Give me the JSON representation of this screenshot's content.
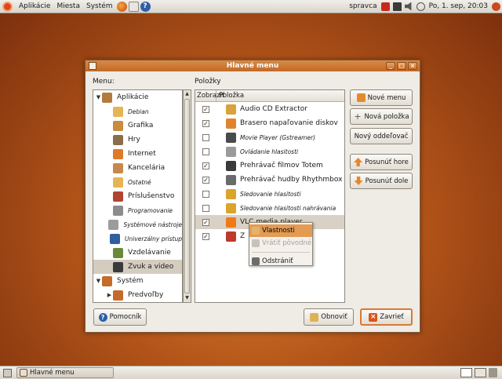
{
  "top_panel": {
    "menus": [
      "Aplikácie",
      "Miesta",
      "Systém"
    ],
    "user": "spravca",
    "clock": "Po, 1. sep, 20:03"
  },
  "window": {
    "title": "Hlavné menu",
    "menus_label": "Menu:",
    "items_label": "Položky",
    "menu_tree": [
      {
        "label": "Aplikácie",
        "expander": "▼",
        "indent": 0,
        "icon_color": "#b37a3e"
      },
      {
        "label": "Debian",
        "indent": 1,
        "italic": true,
        "icon_color": "#e7b455"
      },
      {
        "label": "Grafika",
        "indent": 1,
        "icon_color": "#c98b3d"
      },
      {
        "label": "Hry",
        "indent": 1,
        "icon_color": "#8a6d4a"
      },
      {
        "label": "Internet",
        "indent": 1,
        "icon_color": "#e07a2b"
      },
      {
        "label": "Kancelária",
        "indent": 1,
        "icon_color": "#c7894b"
      },
      {
        "label": "Ostatné",
        "indent": 1,
        "italic": true,
        "icon_color": "#e7b455"
      },
      {
        "label": "Príslušenstvo",
        "indent": 1,
        "icon_color": "#b0442f"
      },
      {
        "label": "Programovanie",
        "indent": 1,
        "italic": true,
        "icon_color": "#8c8c8c"
      },
      {
        "label": "Systémové nástroje",
        "indent": 1,
        "italic": true,
        "icon_color": "#9c9c9c"
      },
      {
        "label": "Univerzálny prístup",
        "indent": 1,
        "italic": true,
        "icon_color": "#2f5f9e"
      },
      {
        "label": "Vzdelávanie",
        "indent": 1,
        "icon_color": "#6a8a3a"
      },
      {
        "label": "Zvuk a video",
        "indent": 1,
        "selected": true,
        "icon_color": "#3a3a3a"
      },
      {
        "label": "Systém",
        "expander": "▼",
        "indent": 0,
        "icon_color": "#c46a2a"
      },
      {
        "label": "Predvoľby",
        "expander": "▶",
        "indent": 1,
        "icon_color": "#c46a2a"
      }
    ],
    "columns": {
      "show": "Zobraziť",
      "item": "Položka"
    },
    "items": [
      {
        "checked": true,
        "label": "Audio CD Extractor",
        "icon_color": "#d8a23c"
      },
      {
        "checked": true,
        "label": "Brasero napaľovanie diskov",
        "icon_color": "#e0842f"
      },
      {
        "checked": false,
        "label": "Movie Player (Gstreamer)",
        "italic": true,
        "icon_color": "#4a4a4a"
      },
      {
        "checked": false,
        "label": "Ovládanie hlasitosti",
        "italic": true,
        "icon_color": "#9a9a9a"
      },
      {
        "checked": true,
        "label": "Prehrávač filmov Totem",
        "icon_color": "#3a3a3a"
      },
      {
        "checked": true,
        "label": "Prehrávač hudby Rhythmbox",
        "icon_color": "#6b6b6b"
      },
      {
        "checked": false,
        "label": "Sledovanie hlasitosti",
        "italic": true,
        "icon_color": "#d9a52a"
      },
      {
        "checked": false,
        "label": "Sledovanie hlasitosti nahrávania",
        "italic": true,
        "icon_color": "#d9a52a"
      },
      {
        "checked": true,
        "label": "VLC media player",
        "selected": true,
        "icon_color": "#f07a16"
      },
      {
        "checked": true,
        "label": "Z",
        "icon_color": "#c0392b"
      }
    ],
    "context_menu": [
      {
        "label": "Vlastnosti",
        "hover": true,
        "icon_color": "#e6b36b"
      },
      {
        "label": "Vrátiť pôvodné",
        "disabled": true,
        "icon_color": "#c8c3b9"
      },
      {
        "separator": true
      },
      {
        "label": "Odstrániť",
        "icon_color": "#6c6c6c"
      }
    ],
    "buttons": {
      "new_menu": "Nové menu",
      "new_item": "Nová položka",
      "new_separator": "Nový oddeľovač",
      "move_up": "Posunúť hore",
      "move_down": "Posunúť dole",
      "help": "Pomocník",
      "revert": "Obnoviť",
      "close": "Zavrieť"
    }
  },
  "bottom_panel": {
    "task_label": "Hlavné menu"
  },
  "colors": {
    "accent": "#d77a37",
    "selection": "#d9d1c5",
    "titlebar": "#c96f2b"
  }
}
